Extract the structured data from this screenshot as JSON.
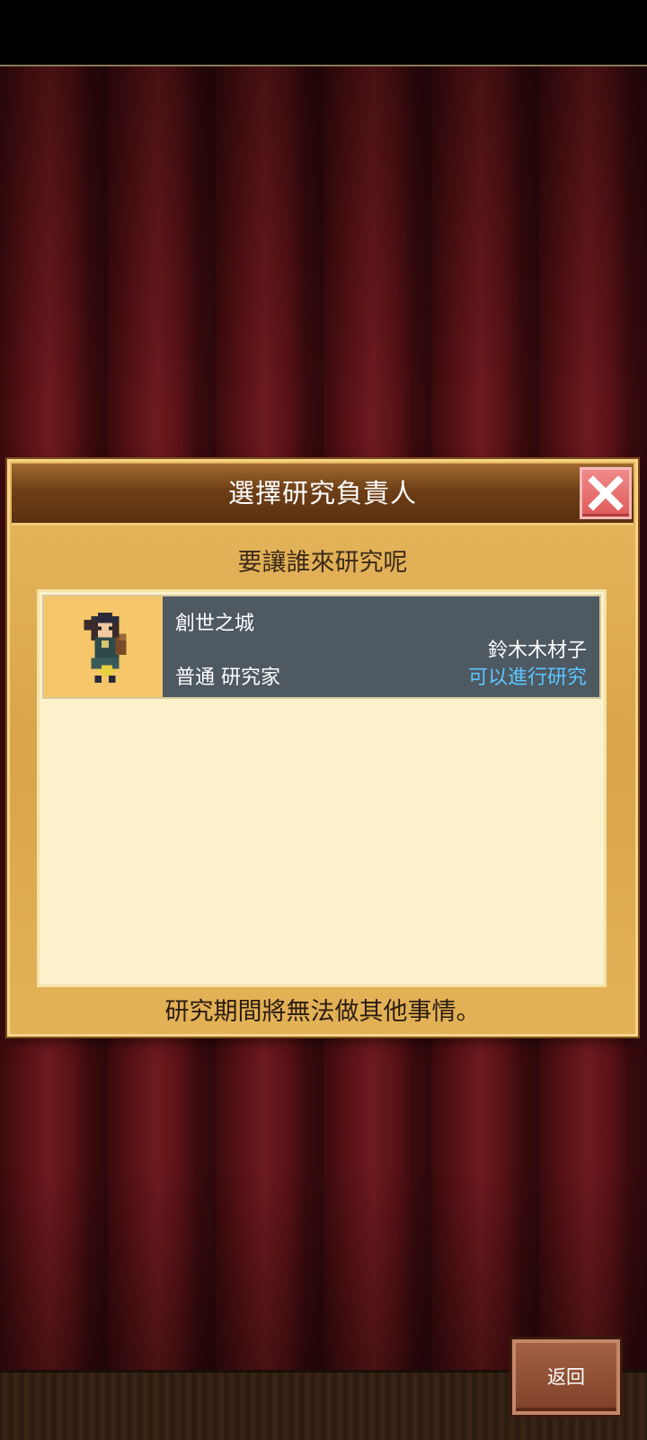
{
  "dialog": {
    "title": "選擇研究負責人",
    "subtitle": "要讓誰來研究呢",
    "footer_note": "研究期間將無法做其他事情。",
    "close_icon": "close-x-icon"
  },
  "researchers": [
    {
      "title": "創世之城",
      "name": "鈴木木材子",
      "role": "普通 研究家",
      "status": "可以進行研究",
      "status_color": "#5cc6ff",
      "avatar_icon": "witch-character-sprite"
    }
  ],
  "back_button": {
    "label": "返回"
  }
}
